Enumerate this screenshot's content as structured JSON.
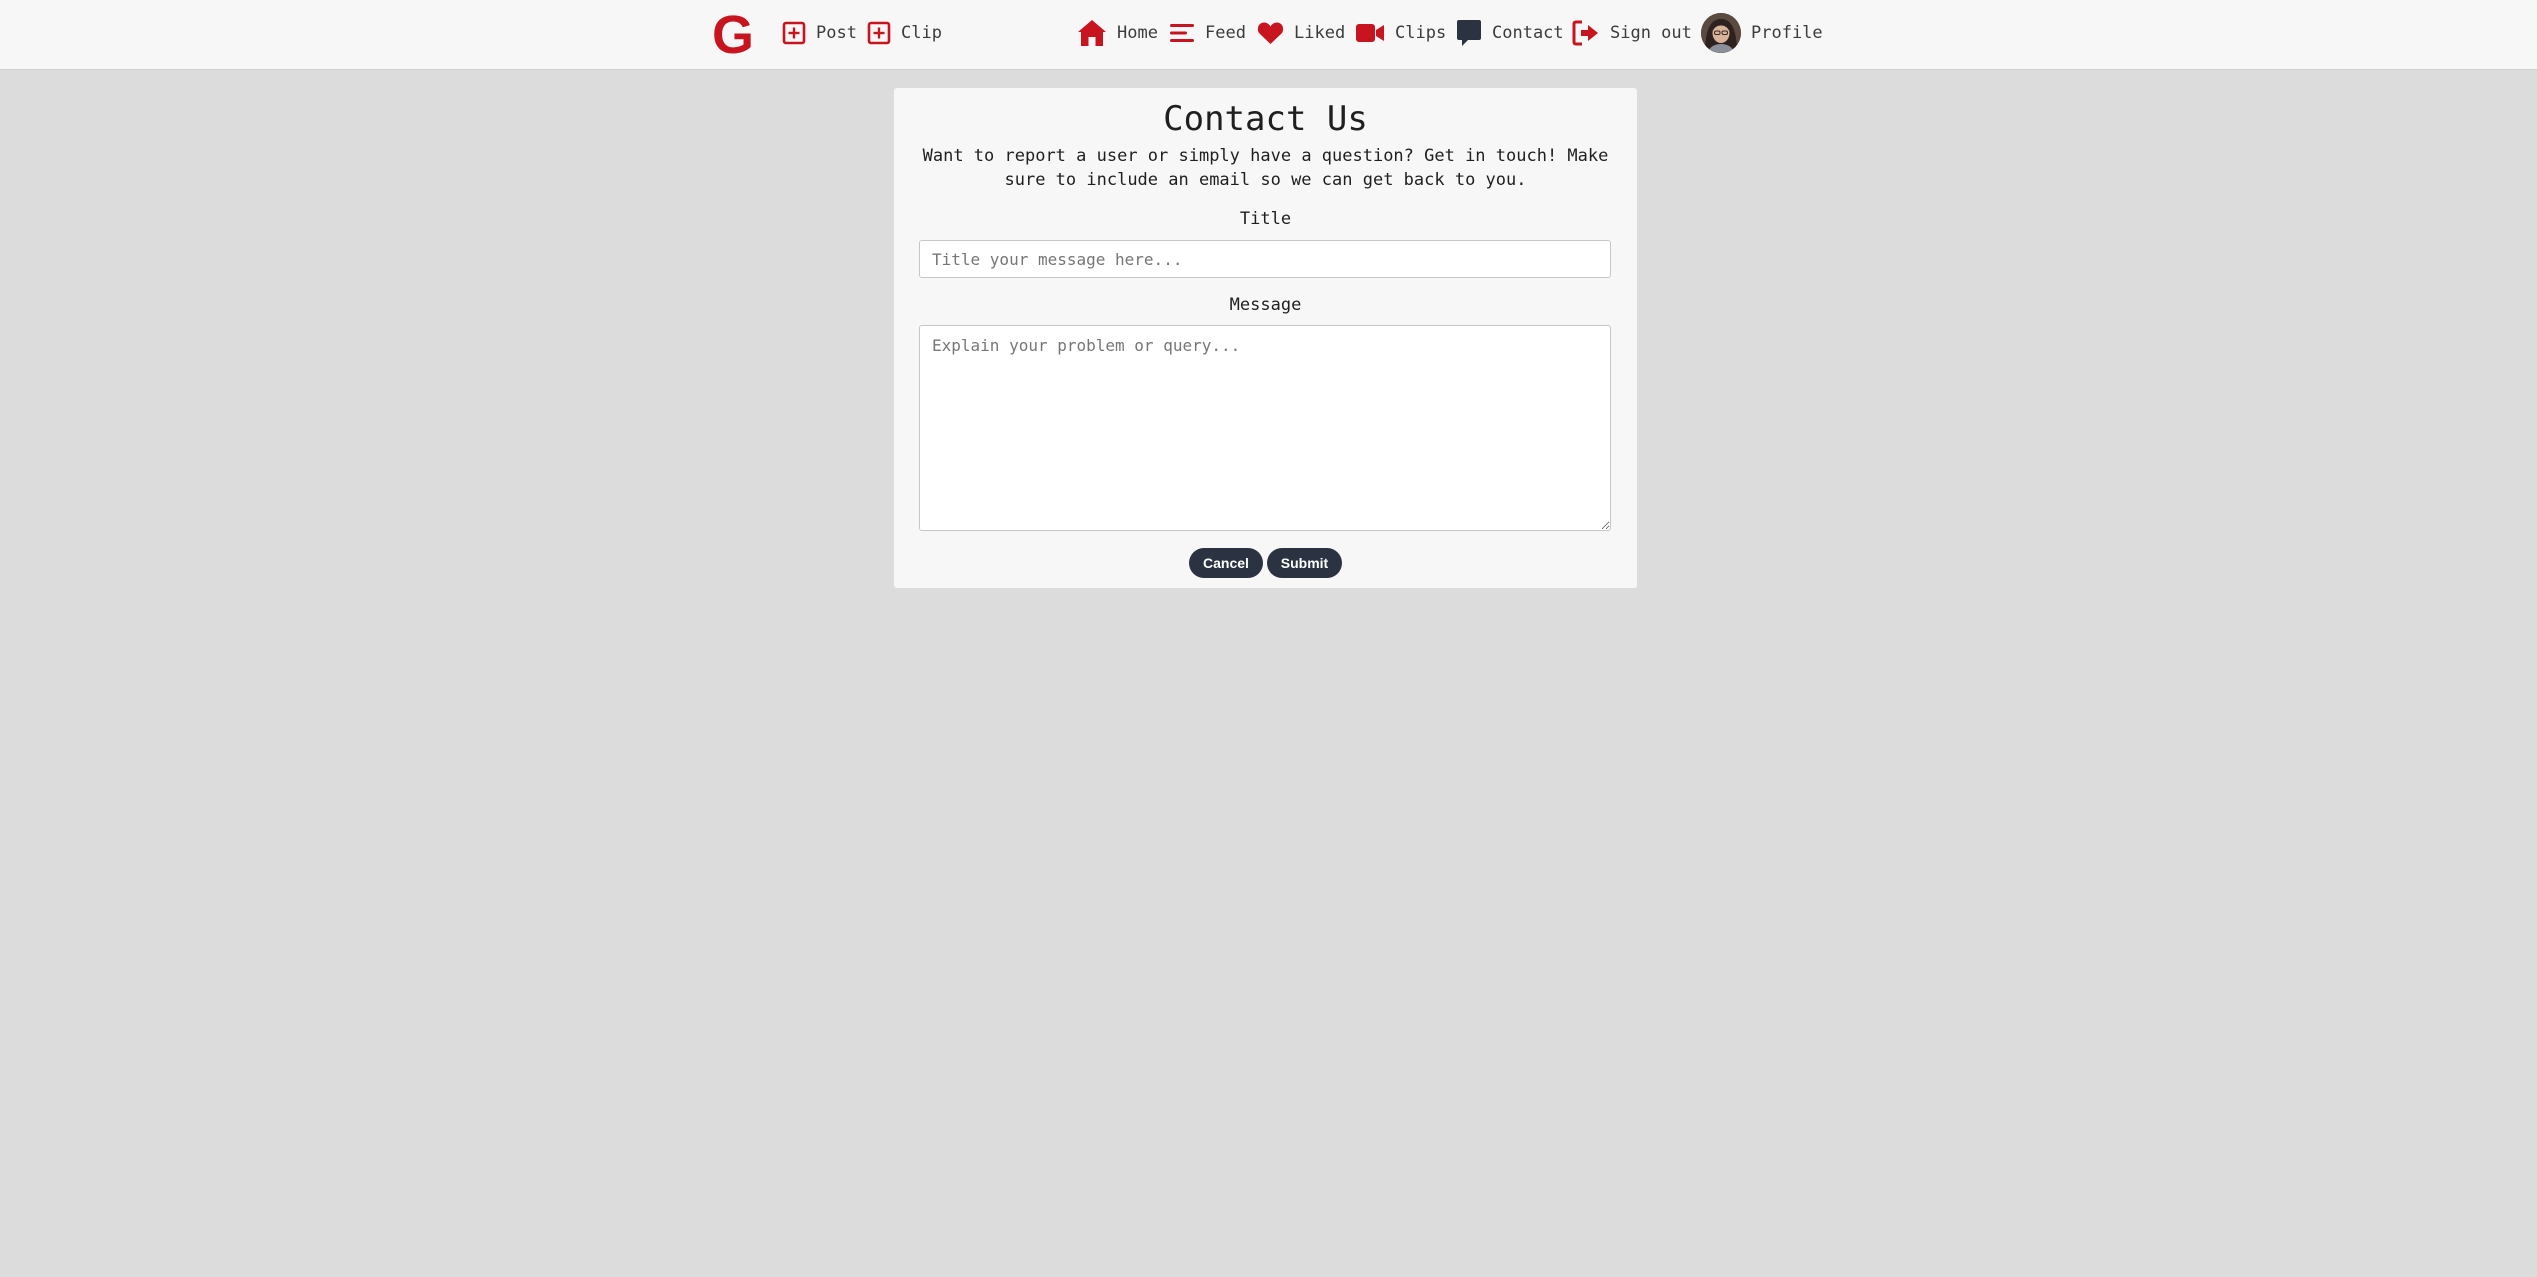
{
  "navbar": {
    "logo": "G",
    "left_items": [
      {
        "label": "Post",
        "icon": "plus-square-icon"
      },
      {
        "label": "Clip",
        "icon": "plus-square-icon"
      }
    ],
    "right_items": [
      {
        "label": "Home",
        "icon": "home-icon"
      },
      {
        "label": "Feed",
        "icon": "menu-lines-icon"
      },
      {
        "label": "Liked",
        "icon": "heart-icon"
      },
      {
        "label": "Clips",
        "icon": "video-camera-icon"
      },
      {
        "label": "Contact",
        "icon": "message-icon"
      },
      {
        "label": "Sign out",
        "icon": "sign-out-icon"
      },
      {
        "label": "Profile",
        "icon": "avatar"
      }
    ]
  },
  "contact": {
    "title": "Contact Us",
    "description": "Want to report a user or simply have a question? Get in touch! Make sure to include an email so we can get back to you.",
    "title_label": "Title",
    "title_placeholder": "Title your message here...",
    "message_label": "Message",
    "message_placeholder": "Explain your problem or query...",
    "cancel_label": "Cancel",
    "submit_label": "Submit"
  },
  "colors": {
    "accent": "#c8141e",
    "nav_dark_icon": "#2b3242",
    "button_bg": "#2b3242",
    "page_bg": "#dcdcdc",
    "card_bg": "#f7f7f7"
  }
}
